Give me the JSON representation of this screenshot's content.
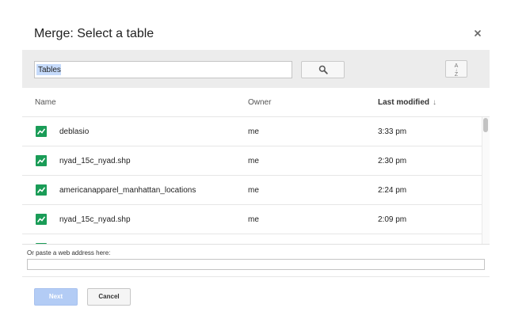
{
  "dialog": {
    "title": "Merge: Select a table",
    "close_icon": "close-icon"
  },
  "toolbar": {
    "search_value": "Tables",
    "search_icon": "search-icon",
    "sort_icon": "sort-az-icon",
    "sort_top": "A",
    "sort_bottom": "Z"
  },
  "table": {
    "columns": {
      "name": "Name",
      "owner": "Owner",
      "modified": "Last modified",
      "sort_arrow": "↓"
    },
    "row_icon": "table-chart-icon",
    "row_icon_color": "#1a9c57",
    "rows": [
      {
        "name": "deblasio",
        "owner": "me",
        "modified": "3:33 pm"
      },
      {
        "name": "nyad_15c_nyad.shp",
        "owner": "me",
        "modified": "2:30 pm"
      },
      {
        "name": "americanapparel_manhattan_locations",
        "owner": "me",
        "modified": "2:24 pm"
      },
      {
        "name": "nyad_15c_nyad.shp",
        "owner": "me",
        "modified": "2:09 pm"
      }
    ]
  },
  "url": {
    "label": "Or paste a web address here:",
    "value": ""
  },
  "footer": {
    "next_label": "Next",
    "cancel_label": "Cancel"
  },
  "colors": {
    "accent": "#b3ccf5",
    "toolbar_bg": "#ececec",
    "selection": "#c6dbfb"
  }
}
